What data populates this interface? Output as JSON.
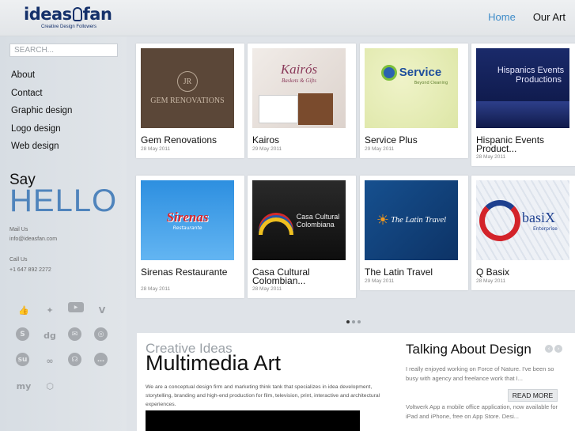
{
  "header": {
    "logo_word1": "ideas",
    "logo_word2": "fan",
    "logo_tagline": "Creative Design Followers",
    "nav": [
      {
        "label": "Home",
        "active": true
      },
      {
        "label": "Our Art",
        "active": false
      }
    ]
  },
  "sidebar": {
    "search_placeholder": "SEARCH...",
    "menu": [
      "About",
      "Contact",
      "Graphic design",
      "Logo design",
      "Web design"
    ],
    "say": "Say",
    "hello": "HELLO",
    "mail_label": "Mail Us",
    "mail_value": "info@ideasfan.com",
    "call_label": "Call Us",
    "call_value": "+1 647 892 2272",
    "social_icons": [
      "like-icon",
      "twitter-icon",
      "youtube-icon",
      "vimeo-icon",
      "skype-icon",
      "digg-icon",
      "mail-icon",
      "dribbble-icon",
      "stumbleupon-icon",
      "lastfm-icon",
      "rss-icon",
      "chat-icon",
      "myspace-icon",
      "dropbox-icon"
    ]
  },
  "portfolio": [
    {
      "title": "Gem Renovations",
      "date": "28 May 2011",
      "thumb_text": "GEM RENOVATIONS",
      "thumb_mark": "JR"
    },
    {
      "title": "Kairos",
      "date": "29 May 2011",
      "thumb_text": "Kairós",
      "thumb_sub": "Baskets & Gifts"
    },
    {
      "title": "Service Plus",
      "date": "29 May 2011",
      "thumb_text": "Service",
      "thumb_sub": "Beyond Cleaning"
    },
    {
      "title": "Hispanic Events Product...",
      "date": "28 May 2011",
      "thumb_text": "Hispanics Events",
      "thumb_sub": "Productions"
    },
    {
      "title": "Sirenas Restaurante",
      "date": "28 May 2011",
      "thumb_text": "Sirenas",
      "thumb_sub": "Restaurante"
    },
    {
      "title": "Casa Cultural Colombian...",
      "date": "28 May 2011",
      "thumb_text": "Casa Cultural",
      "thumb_sub": "Colombiana"
    },
    {
      "title": "The Latin Travel",
      "date": "29 May 2011",
      "thumb_text": "The Latin Travel",
      "thumb_sub": ""
    },
    {
      "title": "Q Basix",
      "date": "28 May 2011",
      "thumb_text": "basiX",
      "thumb_sub": "Enterprise"
    }
  ],
  "pager": {
    "count": 3,
    "active": 0
  },
  "creative": {
    "subtitle": "Creative Ideas",
    "title": "Multimedia Art",
    "description": "We are a conceptual design firm and marketing think tank that specializes in idea development, storytelling, branding and high-end production for film, television, print, interactive and architectural experiences."
  },
  "talk": {
    "title": "Talking About Design",
    "text1": "I really enjoyed working on Force of Nature. I've been so busy with agency and freelance work that I...",
    "read_more": "READ MORE",
    "text2": "Voltwerk App a mobile office application, now available for iPad and iPhone, free on App Store. Desi..."
  },
  "colors": {
    "accent": "#3f8cc9",
    "hello": "#4f84bc",
    "logo": "#14306a"
  }
}
